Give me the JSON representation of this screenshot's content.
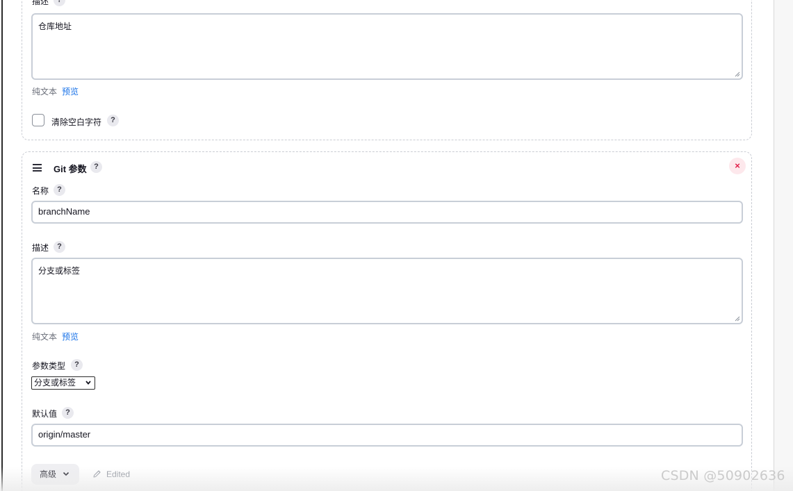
{
  "previous_parameter": {
    "description_label": "描述",
    "description_value": "仓库地址",
    "format_plain": "纯文本",
    "format_preview": "预览",
    "trim_label": "清除空白字符"
  },
  "git_parameter": {
    "title": "Git 参数",
    "name_label": "名称",
    "name_value": "branchName",
    "description_label": "描述",
    "description_value": "分支或标签",
    "format_plain": "纯文本",
    "format_preview": "预览",
    "type_label": "参数类型",
    "type_selected": "分支或标签",
    "default_label": "默认值",
    "default_value": "origin/master",
    "advanced_label": "高级",
    "edited_label": "Edited"
  },
  "help_glyph": "?",
  "close_glyph": "×",
  "watermark": "CSDN @50902636",
  "icons": {
    "help": "question-mark-icon",
    "drag": "drag-handle-icon",
    "close": "close-icon",
    "chevron": "chevron-down-icon",
    "edit": "pencil-icon"
  },
  "colors": {
    "link": "#1a73e8",
    "close_bg": "#fde8ec",
    "close_fg": "#e11d48",
    "border_dashed": "#c9ccd3"
  }
}
